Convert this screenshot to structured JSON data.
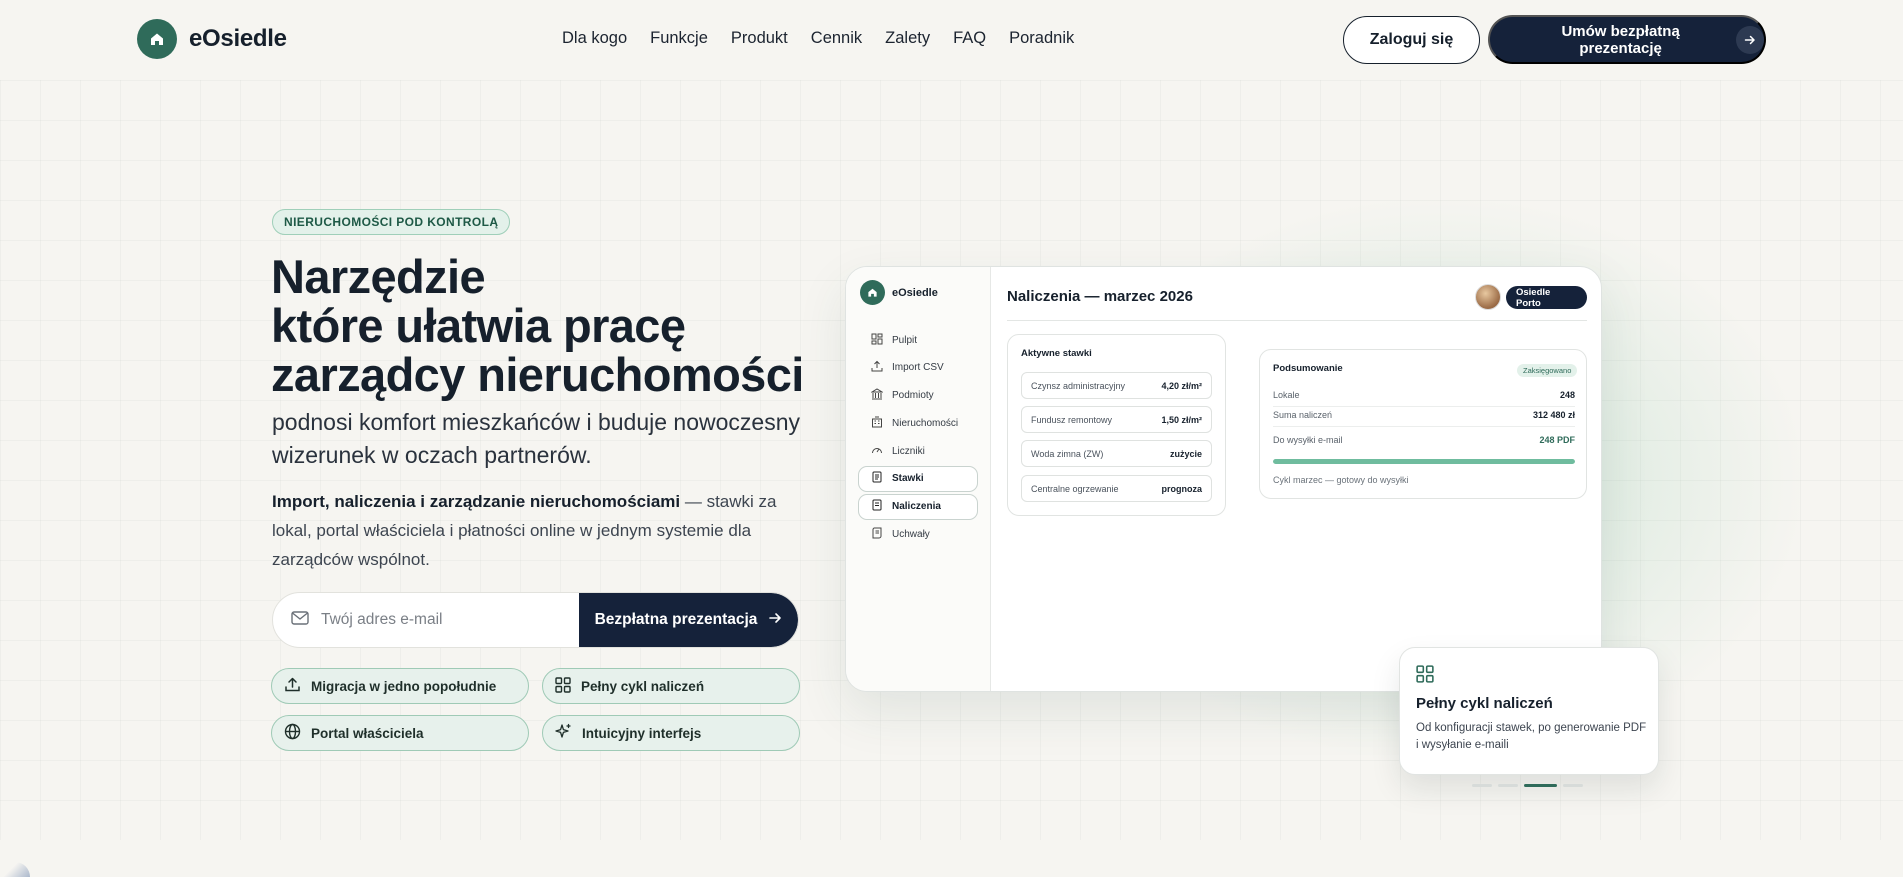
{
  "nav": {
    "brand": "eOsiedle",
    "links": [
      "Dla kogo",
      "Funkcje",
      "Produkt",
      "Cennik",
      "Zalety",
      "FAQ",
      "Poradnik"
    ],
    "login_label": "Zaloguj się",
    "demo_label": "Umów bezpłatną prezentację"
  },
  "hero": {
    "eyebrow": "NIERUCHOMOŚCI POD KONTROLĄ",
    "headline": [
      "Narzędzie",
      "które ułatwia pracę",
      "zarządcy nieruchomości"
    ],
    "subhead": "podnosi komfort mieszkańców i buduje nowoczesny wizerunek w oczach partnerów.",
    "desc_bold": "Import, naliczenia i zarządzanie nieruchomościami",
    "desc_rest": " — stawki za lokal, portal właściciela i płatności online w jednym systemie dla zarządców wspólnot.",
    "email_placeholder": "Twój adres e-mail",
    "cta_label": "Bezpłatna prezentacja",
    "pills": [
      {
        "label": "Migracja w jedno popołudnie",
        "icon": "upload-icon"
      },
      {
        "label": "Pełny cykl naliczeń",
        "icon": "grid-icon"
      },
      {
        "label": "Portal właściciela",
        "icon": "globe-icon"
      },
      {
        "label": "Intuicyjny interfejs",
        "icon": "sparkles-icon"
      }
    ]
  },
  "app": {
    "brand": "eOsiedle",
    "sidebar": [
      {
        "label": "Pulpit",
        "icon": "dashboard-icon",
        "active": false
      },
      {
        "label": "Import CSV",
        "icon": "upload-icon",
        "active": false
      },
      {
        "label": "Podmioty",
        "icon": "bank-icon",
        "active": false
      },
      {
        "label": "Nieruchomości",
        "icon": "building-icon",
        "active": false
      },
      {
        "label": "Liczniki",
        "icon": "gauge-icon",
        "active": false
      },
      {
        "label": "Stawki",
        "icon": "document-icon",
        "active": true
      },
      {
        "label": "Naliczenia",
        "icon": "receipt-icon",
        "active": true
      },
      {
        "label": "Uchwały",
        "icon": "scroll-icon",
        "active": false
      }
    ],
    "title": "Naliczenia — marzec 2026",
    "org": "Osiedle Porto",
    "rates": {
      "title": "Aktywne stawki",
      "rows": [
        {
          "name": "Czynsz administracyjny",
          "value": "4,20 zł/m²"
        },
        {
          "name": "Fundusz remontowy",
          "value": "1,50 zł/m²"
        },
        {
          "name": "Woda zimna (ZW)",
          "value": "zużycie"
        },
        {
          "name": "Centralne ogrzewanie",
          "value": "prognoza"
        }
      ]
    },
    "summary": {
      "title": "Podsumowanie",
      "badge": "Zaksięgowano",
      "lokale_label": "Lokale",
      "lokale_value": "248",
      "suma_label": "Suma naliczeń",
      "suma_value": "312 480 zł",
      "wysylka_label": "Do wysyłki e-mail",
      "wysylka_value": "248 PDF",
      "progress": 1.0,
      "footer": "Cykl marzec — gotowy do wysyłki"
    }
  },
  "float_card": {
    "icon": "grid-icon",
    "title": "Pełny cykl naliczeń",
    "text": "Od konfiguracji stawek, po generowanie PDF i wysyłanie e-maili"
  },
  "carousel": {
    "count": 4,
    "active_index": 2
  },
  "colors": {
    "brand": "#2f6b5a",
    "dark": "#15223a",
    "mint": "#e3f1ea",
    "background": "#f6f5f1"
  }
}
